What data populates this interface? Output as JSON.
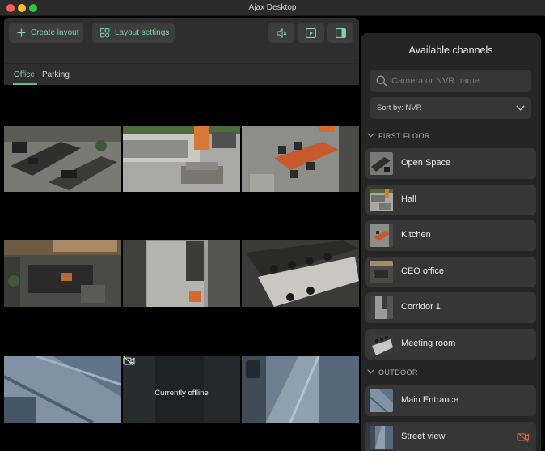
{
  "window": {
    "title": "Ajax Desktop"
  },
  "toolbar": {
    "create_layout": "Create layout",
    "layout_settings": "Layout settings",
    "icons": [
      "mute-icon",
      "play-icon",
      "panel-toggle-icon"
    ]
  },
  "tabs": [
    {
      "label": "Office",
      "active": true
    },
    {
      "label": "Parking",
      "active": false
    }
  ],
  "cameras": [
    {
      "name": "camera-tile-open-space"
    },
    {
      "name": "camera-tile-hall"
    },
    {
      "name": "camera-tile-kitchen"
    },
    {
      "name": "camera-tile-ceo-office"
    },
    {
      "name": "camera-tile-corridor"
    },
    {
      "name": "camera-tile-meeting-room"
    },
    {
      "name": "camera-tile-main-entrance"
    },
    {
      "name": "camera-tile-offline",
      "status_text": "Currently offline"
    },
    {
      "name": "camera-tile-street-view"
    }
  ],
  "panel": {
    "title": "Available channels",
    "search_placeholder": "Camera or NVR name",
    "sort_label": "Sort by: NVR",
    "groups": [
      {
        "name": "FIRST FLOOR",
        "channels": [
          "Open Space",
          "Hall",
          "Kitchen",
          "CEO office",
          "Corridor 1",
          "Meeting room"
        ]
      },
      {
        "name": "OUTDOOR",
        "channels": [
          "Main Entrance",
          "Street view"
        ]
      }
    ]
  },
  "colors": {
    "accent": "#7ed4a4",
    "offline_icon": "#e0664f",
    "panel_bg": "#252525",
    "item_bg": "#363636"
  }
}
